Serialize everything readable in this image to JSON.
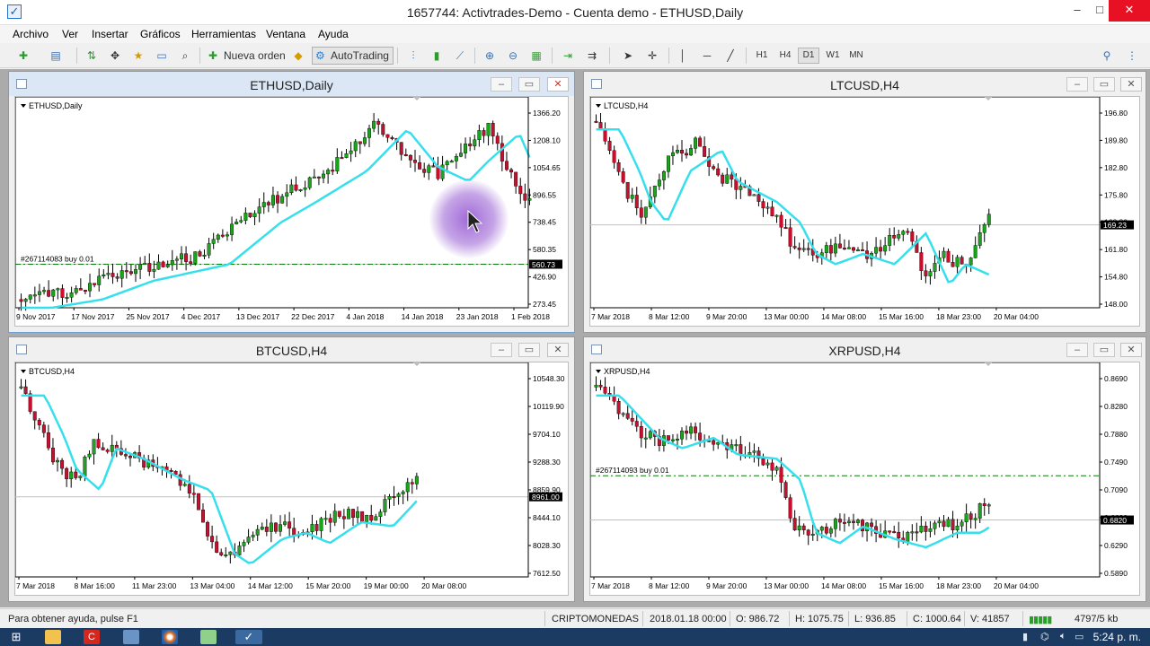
{
  "window": {
    "title": "1657744: Activtrades-Demo - Cuenta demo - ETHUSD,Daily",
    "minimize": "–",
    "maximize": "□",
    "close": "✕"
  },
  "menu": [
    "Archivo",
    "Ver",
    "Insertar",
    "Gráficos",
    "Herramientas",
    "Ventana",
    "Ayuda"
  ],
  "toolbar": {
    "new_order": "Nueva orden",
    "autotrading": "AutoTrading",
    "timeframes": [
      "H1",
      "H4",
      "D1",
      "W1",
      "MN"
    ],
    "active_timeframe": "D1"
  },
  "charts": [
    {
      "title": "ETHUSD,Daily",
      "label": "ETHUSD,Daily",
      "active": true,
      "y_ticks": [
        "1366.20",
        "1208.10",
        "1054.65",
        "896.55",
        "738.45",
        "580.35",
        "426.90",
        "273.45"
      ],
      "x_ticks": [
        "9 Nov 2017",
        "17 Nov 2017",
        "25 Nov 2017",
        "4 Dec 2017",
        "13 Dec 2017",
        "22 Dec 2017",
        "4 Jan 2018",
        "14 Jan 2018",
        "23 Jan 2018",
        "1 Feb 2018"
      ],
      "price_label": "560.73",
      "order_label": "#267114083 buy 0.01"
    },
    {
      "title": "LTCUSD,H4",
      "label": "LTCUSD,H4",
      "active": false,
      "y_ticks": [
        "196.80",
        "189.80",
        "182.80",
        "175.80",
        "168.80",
        "161.80",
        "154.80",
        "148.00"
      ],
      "x_ticks": [
        "7 Mar 2018",
        "8 Mar 12:00",
        "9 Mar 20:00",
        "13 Mar 00:00",
        "14 Mar 08:00",
        "15 Mar 16:00",
        "18 Mar 23:00",
        "20 Mar 04:00"
      ],
      "price_label": "169.23",
      "order_label": ""
    },
    {
      "title": "BTCUSD,H4",
      "label": "BTCUSD,H4",
      "active": false,
      "y_ticks": [
        "10548.30",
        "10119.90",
        "9704.10",
        "9288.30",
        "8859.90",
        "8444.10",
        "8028.30",
        "7612.50"
      ],
      "x_ticks": [
        "7 Mar 2018",
        "8 Mar 16:00",
        "11 Mar 23:00",
        "13 Mar 04:00",
        "14 Mar 12:00",
        "15 Mar 20:00",
        "19 Mar 00:00",
        "20 Mar 08:00"
      ],
      "price_label": "8961.00",
      "order_label": ""
    },
    {
      "title": "XRPUSD,H4",
      "label": "XRPUSD,H4",
      "active": false,
      "y_ticks": [
        "0.8690",
        "0.8280",
        "0.7880",
        "0.7490",
        "0.7090",
        "0.6690",
        "0.6290",
        "0.5890"
      ],
      "x_ticks": [
        "7 Mar 2018",
        "8 Mar 12:00",
        "9 Mar 20:00",
        "13 Mar 00:00",
        "14 Mar 08:00",
        "15 Mar 16:00",
        "18 Mar 23:00",
        "20 Mar 04:00"
      ],
      "price_label": "0.6820",
      "order_label": "#267114093 buy 0.01"
    }
  ],
  "status": {
    "help": "Para obtener ayuda, pulse F1",
    "profile": "CRIPTOMONEDAS",
    "datetime": "2018.01.18 00:00",
    "open": "O: 986.72",
    "high": "H: 1075.75",
    "low": "L: 936.85",
    "close": "C: 1000.64",
    "volume": "V: 41857",
    "traffic": "4797/5 kb"
  },
  "taskbar": {
    "clock": "5:24 p. m."
  },
  "colors": {
    "bull": "#1aa51a",
    "bear": "#c8102e",
    "ma": "#35e0ec",
    "trade_line": "#008000"
  }
}
